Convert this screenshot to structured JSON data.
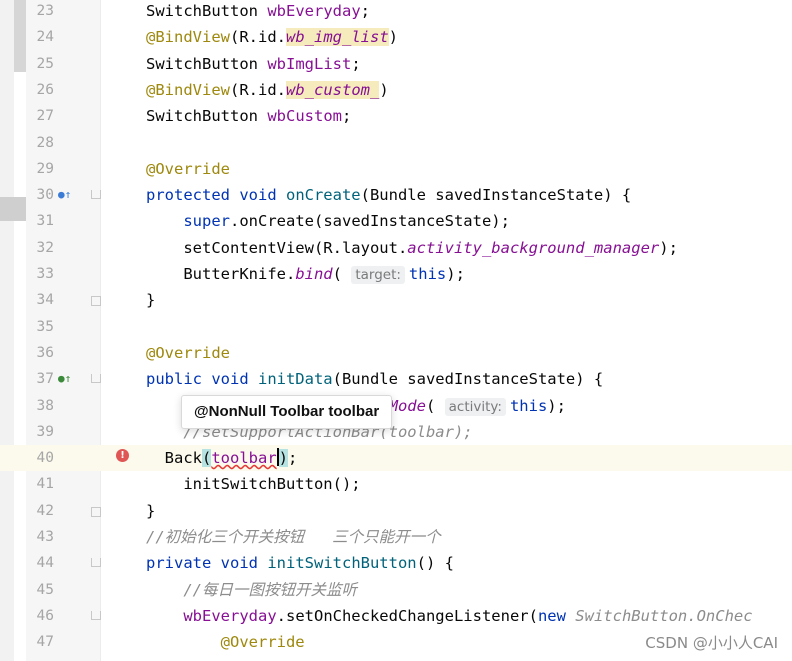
{
  "editor": {
    "lines": [
      {
        "n": "23",
        "tokens": [
          {
            "t": "SwitchButton "
          },
          {
            "t": "wbEveryday",
            "c": "var"
          },
          {
            "t": ";"
          }
        ]
      },
      {
        "n": "24",
        "tokens": [
          {
            "t": "@BindView",
            "c": "ann"
          },
          {
            "t": "(R.id."
          },
          {
            "t": "wb_img_list",
            "c": "st hl"
          },
          {
            "t": ")"
          }
        ]
      },
      {
        "n": "25",
        "tokens": [
          {
            "t": "SwitchButton "
          },
          {
            "t": "wbImgList",
            "c": "var"
          },
          {
            "t": ";"
          }
        ]
      },
      {
        "n": "26",
        "tokens": [
          {
            "t": "@BindView",
            "c": "ann"
          },
          {
            "t": "(R.id."
          },
          {
            "t": "wb_custom_",
            "c": "st hl"
          },
          {
            "t": ")"
          }
        ]
      },
      {
        "n": "27",
        "tokens": [
          {
            "t": "SwitchButton "
          },
          {
            "t": "wbCustom",
            "c": "var"
          },
          {
            "t": ";"
          }
        ]
      },
      {
        "n": "28",
        "tokens": []
      },
      {
        "n": "29",
        "tokens": [
          {
            "t": "@Override",
            "c": "ann"
          }
        ]
      },
      {
        "n": "30",
        "gutter": "override",
        "fold": "bookmark",
        "tokens": [
          {
            "t": "protected void ",
            "c": "kw"
          },
          {
            "t": "onCreate",
            "c": "fn"
          },
          {
            "t": "(Bundle savedInstanceState) {"
          }
        ]
      },
      {
        "n": "31",
        "tokens": [
          {
            "t": "    "
          },
          {
            "t": "super",
            "c": "kw"
          },
          {
            "t": ".onCreate(savedInstanceState);"
          }
        ]
      },
      {
        "n": "32",
        "tokens": [
          {
            "t": "    setContentView(R.layout."
          },
          {
            "t": "activity_background_manager",
            "c": "st"
          },
          {
            "t": ");"
          }
        ]
      },
      {
        "n": "33",
        "tokens": [
          {
            "t": "    ButterKnife."
          },
          {
            "t": "bind",
            "c": "st"
          },
          {
            "t": "( "
          },
          {
            "t": "target:",
            "c": "hint"
          },
          {
            "t": "this",
            "c": "kw"
          },
          {
            "t": ");"
          }
        ]
      },
      {
        "n": "34",
        "fold": "open",
        "tokens": [
          {
            "t": "}"
          }
        ]
      },
      {
        "n": "35",
        "tokens": []
      },
      {
        "n": "36",
        "tokens": [
          {
            "t": "@Override",
            "c": "ann"
          }
        ]
      },
      {
        "n": "37",
        "gutter": "implement",
        "fold": "bookmark",
        "tokens": [
          {
            "t": "public void ",
            "c": "kw"
          },
          {
            "t": "initData",
            "c": "fn"
          },
          {
            "t": "(Bundle savedInstanceState) {"
          }
        ]
      },
      {
        "n": "38",
        "tokens": [
          {
            "t": "                    "
          },
          {
            "t": "rLightMode",
            "c": "st"
          },
          {
            "t": "( "
          },
          {
            "t": "activity:",
            "c": "hint"
          },
          {
            "t": "this",
            "c": "kw"
          },
          {
            "t": ");"
          }
        ]
      },
      {
        "n": "39",
        "tokens": [
          {
            "t": "    //setSupportActionBar(toolbar);",
            "c": "cm"
          }
        ]
      },
      {
        "n": "40",
        "current": true,
        "error": true,
        "tokens": [
          {
            "t": "  Back"
          },
          {
            "t": "(",
            "c": "brace-hl"
          },
          {
            "t": "toolbar",
            "c": "var err"
          },
          {
            "t": "CARET"
          },
          {
            "t": ")",
            "c": "brace-hl"
          },
          {
            "t": ";"
          }
        ]
      },
      {
        "n": "41",
        "tokens": [
          {
            "t": "    initSwitchButton();"
          }
        ]
      },
      {
        "n": "42",
        "fold": "open",
        "tokens": [
          {
            "t": "}"
          }
        ]
      },
      {
        "n": "43",
        "tokens": [
          {
            "t": "//初始化三个开关按钮   三个只能开一个",
            "c": "cm"
          }
        ]
      },
      {
        "n": "44",
        "fold": "bookmark",
        "tokens": [
          {
            "t": "private void ",
            "c": "kw"
          },
          {
            "t": "initSwitchButton",
            "c": "fn"
          },
          {
            "t": "() {"
          }
        ]
      },
      {
        "n": "45",
        "tokens": [
          {
            "t": "    "
          },
          {
            "t": "//每日一图按钮开关监听",
            "c": "cm"
          }
        ]
      },
      {
        "n": "46",
        "fold": "bookmark",
        "tokens": [
          {
            "t": "    "
          },
          {
            "t": "wbEveryday",
            "c": "var"
          },
          {
            "t": ".setOnCheckedChangeListener("
          },
          {
            "t": "new ",
            "c": "kw"
          },
          {
            "t": "SwitchButton.OnChec",
            "c": "cm"
          }
        ]
      },
      {
        "n": "47",
        "tokens": [
          {
            "t": "        "
          },
          {
            "t": "@Override",
            "c": "ann"
          }
        ]
      }
    ]
  },
  "tooltip": {
    "text": "@NonNull Toolbar toolbar"
  },
  "watermark": {
    "text": "CSDN @小小人CAI"
  }
}
